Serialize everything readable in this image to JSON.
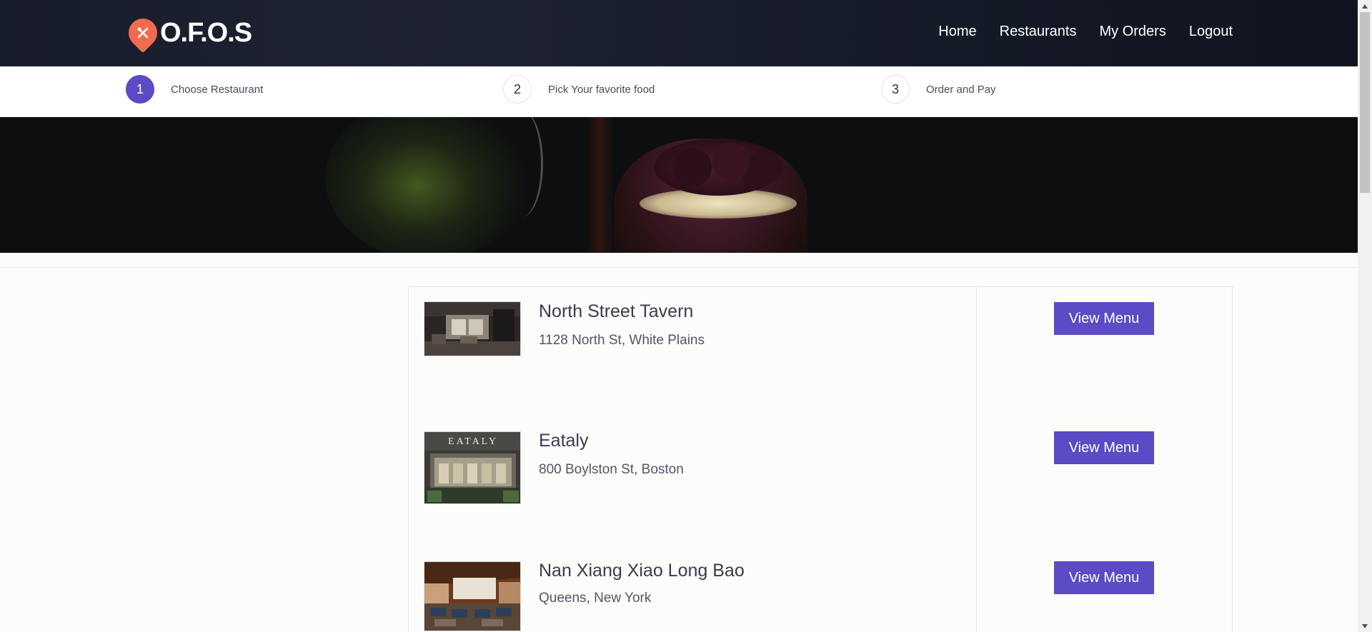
{
  "nav": {
    "brand": "O.F.O.S",
    "links": [
      "Home",
      "Restaurants",
      "My Orders",
      "Logout"
    ]
  },
  "steps": [
    {
      "number": "1",
      "label": "Choose Restaurant",
      "active": true
    },
    {
      "number": "2",
      "label": "Pick Your favorite food",
      "active": false
    },
    {
      "number": "3",
      "label": "Order and Pay",
      "active": false
    }
  ],
  "restaurants": [
    {
      "name": "North Street Tavern",
      "address": "1128 North St, White Plains",
      "button": "View Menu"
    },
    {
      "name": "Eataly",
      "address": "800 Boylston St, Boston",
      "button": "View Menu",
      "sign_text": "EATALY"
    },
    {
      "name": "Nan Xiang Xiao Long Bao",
      "address": "Queens, New York",
      "button": "View Menu"
    }
  ],
  "colors": {
    "accent": "#5b4bc4",
    "brand_pin": "#f26b4f",
    "navbar": "#151a28"
  },
  "icons": {
    "brand": "fork-knife-pin-icon",
    "scroll_up": "triangle-up-icon",
    "scroll_down": "triangle-down-icon"
  }
}
